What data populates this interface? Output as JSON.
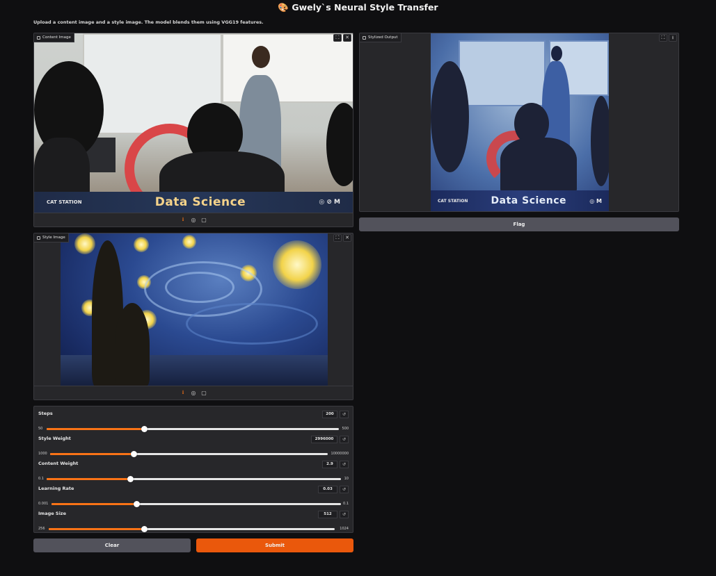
{
  "header": {
    "icon": "palette-icon",
    "title": "Gwely`s Neural Style Transfer",
    "description": "Upload a content image and a style image. The model blends them using VGG19 features."
  },
  "content_image": {
    "label": "Content Image",
    "banner_text": "Data Science",
    "banner_logo": "CAT STATION",
    "banner_right": "◎ ⊘ M"
  },
  "style_image": {
    "label": "Style Image"
  },
  "styled_output": {
    "label": "Stylized Output",
    "banner_text": "Data Science",
    "banner_logo": "CAT STATION",
    "banner_right": "◎ M"
  },
  "flag_button": "Flag",
  "sliders": [
    {
      "label": "Steps",
      "value": "200",
      "min": "50",
      "max": "500",
      "fraction": 0.333
    },
    {
      "label": "Style Weight",
      "value": "2996000",
      "min": "1000",
      "max": "10000000",
      "fraction": 0.3
    },
    {
      "label": "Content Weight",
      "value": "2.9",
      "min": "0.1",
      "max": "10",
      "fraction": 0.283
    },
    {
      "label": "Learning Rate",
      "value": "0.03",
      "min": "0.001",
      "max": "0.1",
      "fraction": 0.293
    },
    {
      "label": "Image Size",
      "value": "512",
      "min": "256",
      "max": "1024",
      "fraction": 0.333
    }
  ],
  "buttons": {
    "clear": "Clear",
    "submit": "Submit"
  },
  "colors": {
    "accent": "#f97316",
    "submit": "#ea580c",
    "panel": "#27272a",
    "background": "#0f0f11"
  }
}
